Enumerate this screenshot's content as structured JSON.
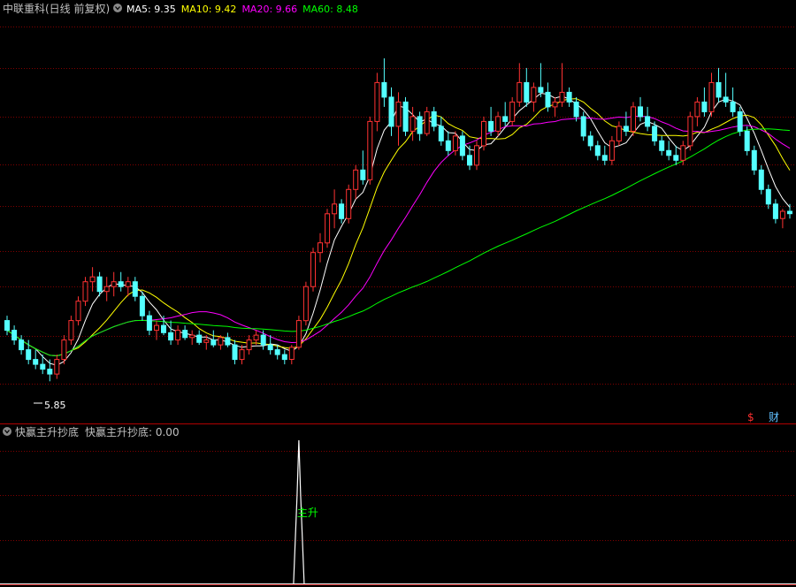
{
  "main_panel": {
    "stock_title": "中联重科",
    "period_label": "(日线 前复权)",
    "ma_legend": [
      {
        "label": "MA5: 9.35",
        "color": "#ffffff"
      },
      {
        "label": "MA10: 9.42",
        "color": "#ffff00"
      },
      {
        "label": "MA20: 9.66",
        "color": "#ff00ff"
      },
      {
        "label": "MA60: 8.48",
        "color": "#00ff00"
      }
    ],
    "low_marker": "5.85",
    "corner_icons": [
      {
        "symbol": "$",
        "color": "#ff3030"
      },
      {
        "symbol": "财",
        "color": "#60c0ff"
      }
    ]
  },
  "indicator_panel": {
    "name": "快赢主升抄底",
    "value_label": "快赢主升抄底: 0.00",
    "signal_label": "主升"
  },
  "colors": {
    "up_candle": "#ff3232",
    "down_candle": "#54ffff",
    "grid": "#800000",
    "title_text": "#c0c0c0",
    "signal_line": "#ffffff",
    "signal_label": "#00ff00"
  },
  "chart_data": {
    "type": "candlestick",
    "price_axis_range": [
      5.0,
      13.3
    ],
    "ohlc_fields": [
      "open",
      "high",
      "low",
      "close"
    ],
    "candles": [
      [
        7.1,
        7.2,
        6.8,
        6.9
      ],
      [
        6.9,
        7.0,
        6.6,
        6.7
      ],
      [
        6.7,
        6.8,
        6.4,
        6.5
      ],
      [
        6.5,
        6.7,
        6.2,
        6.3
      ],
      [
        6.3,
        6.5,
        6.1,
        6.2
      ],
      [
        6.2,
        6.4,
        6.0,
        6.1
      ],
      [
        6.1,
        6.3,
        5.85,
        6.0
      ],
      [
        6.0,
        6.4,
        5.9,
        6.3
      ],
      [
        6.3,
        6.8,
        6.2,
        6.7
      ],
      [
        6.7,
        7.2,
        6.6,
        7.1
      ],
      [
        7.1,
        7.6,
        7.0,
        7.5
      ],
      [
        7.5,
        8.0,
        7.4,
        7.9
      ],
      [
        7.9,
        8.2,
        7.7,
        8.0
      ],
      [
        8.0,
        8.1,
        7.6,
        7.7
      ],
      [
        7.7,
        8.0,
        7.5,
        7.8
      ],
      [
        7.8,
        8.1,
        7.6,
        7.9
      ],
      [
        7.9,
        8.1,
        7.7,
        7.8
      ],
      [
        7.8,
        8.0,
        7.6,
        7.9
      ],
      [
        7.9,
        8.0,
        7.5,
        7.6
      ],
      [
        7.6,
        7.7,
        7.1,
        7.2
      ],
      [
        7.2,
        7.3,
        6.8,
        6.9
      ],
      [
        6.9,
        7.1,
        6.7,
        7.0
      ],
      [
        7.0,
        7.2,
        6.8,
        6.85
      ],
      [
        6.85,
        7.1,
        6.6,
        6.7
      ],
      [
        6.7,
        7.0,
        6.6,
        6.9
      ],
      [
        6.9,
        7.0,
        6.7,
        6.75
      ],
      [
        6.75,
        6.9,
        6.6,
        6.8
      ],
      [
        6.8,
        6.9,
        6.6,
        6.65
      ],
      [
        6.65,
        6.8,
        6.5,
        6.7
      ],
      [
        6.7,
        6.9,
        6.55,
        6.6
      ],
      [
        6.6,
        6.8,
        6.5,
        6.75
      ],
      [
        6.75,
        6.85,
        6.55,
        6.6
      ],
      [
        6.6,
        6.7,
        6.2,
        6.3
      ],
      [
        6.3,
        6.6,
        6.2,
        6.5
      ],
      [
        6.5,
        6.8,
        6.4,
        6.7
      ],
      [
        6.7,
        6.9,
        6.6,
        6.8
      ],
      [
        6.8,
        6.9,
        6.5,
        6.6
      ],
      [
        6.6,
        6.8,
        6.4,
        6.5
      ],
      [
        6.5,
        6.6,
        6.3,
        6.4
      ],
      [
        6.4,
        6.5,
        6.2,
        6.3
      ],
      [
        6.3,
        6.6,
        6.2,
        6.55
      ],
      [
        6.55,
        7.2,
        6.5,
        7.1
      ],
      [
        7.1,
        7.9,
        7.0,
        7.8
      ],
      [
        7.8,
        8.6,
        7.7,
        8.5
      ],
      [
        8.5,
        8.9,
        8.3,
        8.7
      ],
      [
        8.7,
        9.4,
        8.6,
        9.3
      ],
      [
        9.3,
        9.8,
        9.0,
        9.5
      ],
      [
        9.5,
        9.6,
        9.1,
        9.2
      ],
      [
        9.2,
        9.9,
        9.1,
        9.8
      ],
      [
        9.8,
        10.3,
        9.6,
        10.2
      ],
      [
        10.2,
        10.6,
        9.9,
        10.0
      ],
      [
        10.0,
        11.3,
        9.9,
        11.2
      ],
      [
        11.2,
        12.2,
        11.0,
        12.0
      ],
      [
        12.0,
        12.5,
        11.5,
        11.7
      ],
      [
        11.7,
        11.9,
        10.9,
        11.1
      ],
      [
        11.1,
        11.8,
        10.7,
        11.6
      ],
      [
        11.6,
        11.7,
        10.9,
        11.0
      ],
      [
        11.0,
        11.5,
        10.8,
        11.3
      ],
      [
        11.3,
        11.4,
        10.8,
        10.95
      ],
      [
        10.95,
        11.5,
        10.9,
        11.4
      ],
      [
        11.4,
        11.5,
        11.0,
        11.1
      ],
      [
        11.1,
        11.3,
        10.7,
        10.8
      ],
      [
        10.8,
        11.0,
        10.5,
        10.6
      ],
      [
        10.6,
        11.0,
        10.5,
        10.9
      ],
      [
        10.9,
        11.0,
        10.4,
        10.5
      ],
      [
        10.5,
        10.7,
        10.2,
        10.3
      ],
      [
        10.3,
        10.8,
        10.2,
        10.7
      ],
      [
        10.7,
        11.3,
        10.6,
        11.2
      ],
      [
        11.2,
        11.5,
        10.9,
        11.0
      ],
      [
        11.0,
        11.4,
        10.9,
        11.3
      ],
      [
        11.3,
        11.6,
        11.1,
        11.2
      ],
      [
        11.2,
        11.7,
        11.1,
        11.6
      ],
      [
        11.6,
        12.4,
        11.5,
        12.0
      ],
      [
        12.0,
        12.3,
        11.5,
        11.6
      ],
      [
        11.6,
        12.0,
        11.4,
        11.9
      ],
      [
        11.9,
        12.4,
        11.7,
        11.8
      ],
      [
        11.8,
        12.0,
        11.4,
        11.5
      ],
      [
        11.5,
        11.7,
        11.3,
        11.6
      ],
      [
        11.6,
        12.4,
        11.5,
        11.8
      ],
      [
        11.8,
        11.9,
        11.5,
        11.6
      ],
      [
        11.6,
        11.7,
        11.2,
        11.3
      ],
      [
        11.3,
        11.4,
        10.8,
        10.9
      ],
      [
        10.9,
        11.0,
        10.6,
        10.7
      ],
      [
        10.7,
        10.8,
        10.4,
        10.5
      ],
      [
        10.5,
        10.7,
        10.3,
        10.4
      ],
      [
        10.4,
        10.9,
        10.3,
        10.8
      ],
      [
        10.8,
        11.2,
        10.7,
        11.1
      ],
      [
        11.1,
        11.4,
        10.9,
        11.0
      ],
      [
        11.0,
        11.6,
        10.9,
        11.5
      ],
      [
        11.5,
        11.7,
        11.2,
        11.3
      ],
      [
        11.3,
        11.5,
        11.0,
        11.1
      ],
      [
        11.1,
        11.2,
        10.7,
        10.8
      ],
      [
        10.8,
        10.9,
        10.5,
        10.6
      ],
      [
        10.6,
        10.8,
        10.4,
        10.5
      ],
      [
        10.5,
        10.7,
        10.3,
        10.4
      ],
      [
        10.4,
        10.8,
        10.3,
        10.7
      ],
      [
        10.7,
        11.4,
        10.6,
        11.3
      ],
      [
        11.3,
        11.7,
        11.1,
        11.6
      ],
      [
        11.6,
        11.9,
        11.3,
        11.4
      ],
      [
        11.4,
        12.2,
        11.3,
        12.0
      ],
      [
        12.0,
        12.3,
        11.6,
        11.7
      ],
      [
        11.7,
        12.2,
        11.5,
        11.6
      ],
      [
        11.6,
        11.9,
        11.3,
        11.4
      ],
      [
        11.4,
        11.5,
        10.9,
        11.0
      ],
      [
        11.0,
        11.1,
        10.5,
        10.6
      ],
      [
        10.6,
        10.7,
        10.1,
        10.2
      ],
      [
        10.2,
        10.3,
        9.7,
        9.8
      ],
      [
        9.8,
        9.9,
        9.4,
        9.5
      ],
      [
        9.5,
        9.6,
        9.1,
        9.2
      ],
      [
        9.2,
        9.4,
        9.0,
        9.35
      ],
      [
        9.35,
        9.5,
        9.2,
        9.3
      ]
    ],
    "moving_averages": [
      {
        "label": "MA5",
        "period": 5,
        "latest": 9.35
      },
      {
        "label": "MA10",
        "period": 10,
        "latest": 9.42
      },
      {
        "label": "MA20",
        "period": 20,
        "latest": 9.66
      },
      {
        "label": "MA60",
        "period": 60,
        "latest": 8.48
      }
    ],
    "indicator": {
      "name": "快赢主升抄底",
      "latest_value": 0.0,
      "signal_index": 41,
      "signal_label": "主升"
    }
  }
}
